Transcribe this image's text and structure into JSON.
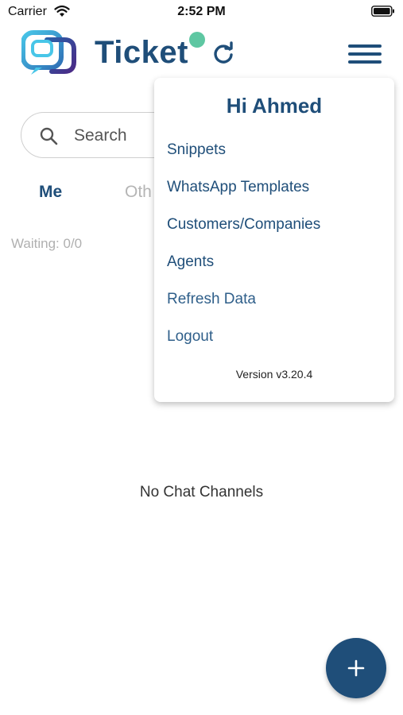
{
  "status_bar": {
    "carrier": "Carrier",
    "time": "2:52 PM"
  },
  "header": {
    "brand": "Ticket"
  },
  "search": {
    "placeholder": "Search"
  },
  "tabs": [
    {
      "label": "Me"
    },
    {
      "label": "Oth"
    }
  ],
  "waiting": "Waiting: 0/0",
  "empty_state": "No Chat Channels",
  "menu": {
    "greeting": "Hi Ahmed",
    "items": [
      {
        "label": "Snippets"
      },
      {
        "label": "WhatsApp Templates"
      },
      {
        "label": "Customers/Companies"
      },
      {
        "label": "Agents"
      },
      {
        "label": "Refresh Data"
      },
      {
        "label": "Logout"
      }
    ],
    "version": "Version v3.20.4"
  },
  "colors": {
    "brand": "#1f4e79",
    "online": "#5ec7a2",
    "muted": "#b0b0b0"
  }
}
